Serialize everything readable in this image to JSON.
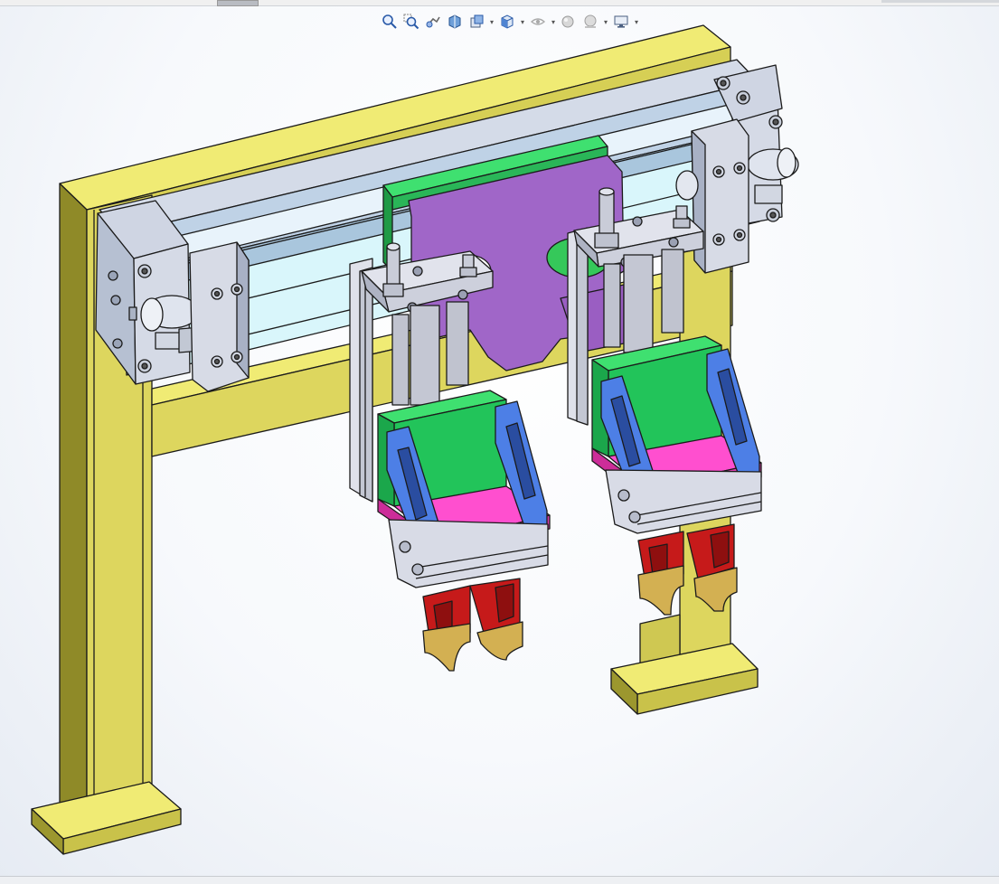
{
  "window": {
    "title": ""
  },
  "heads_up_toolbar": {
    "buttons": [
      {
        "id": "zoom-to-fit",
        "icon": "zoom-to-fit-icon"
      },
      {
        "id": "zoom-to-area",
        "icon": "zoom-to-area-icon"
      },
      {
        "id": "previous-view",
        "icon": "previous-view-icon"
      },
      {
        "id": "section-view",
        "icon": "section-view-icon"
      },
      {
        "id": "dynamic-annotation",
        "icon": "dynamic-annotation-icon",
        "dropdown": true
      },
      {
        "id": "view-orientation",
        "icon": "view-orientation-icon",
        "dropdown": true
      },
      {
        "id": "display-style",
        "icon": "display-style-icon",
        "dropdown": true
      },
      {
        "id": "hide-show-items",
        "icon": "hide-show-items-icon"
      },
      {
        "id": "edit-appearance",
        "icon": "edit-appearance-icon",
        "dropdown": true
      },
      {
        "id": "view-settings",
        "icon": "view-settings-icon",
        "dropdown": true
      }
    ]
  },
  "model": {
    "description_visible": false,
    "colors": {
      "frame_yellow": "#e7e16a",
      "frame_yellow_dark": "#b7b03c",
      "rail_blue": "#c7dcee",
      "rail_grey": "#c9ccd6",
      "plate_purple": "#a066c8",
      "plate_green": "#35c85a",
      "bracket_blue": "#4d7fe6",
      "base_magenta": "#ff4fcf",
      "jaw_red": "#c61a1a",
      "jaw_gold": "#c9a64a",
      "block_lightgrey": "#d8dbe6"
    }
  }
}
